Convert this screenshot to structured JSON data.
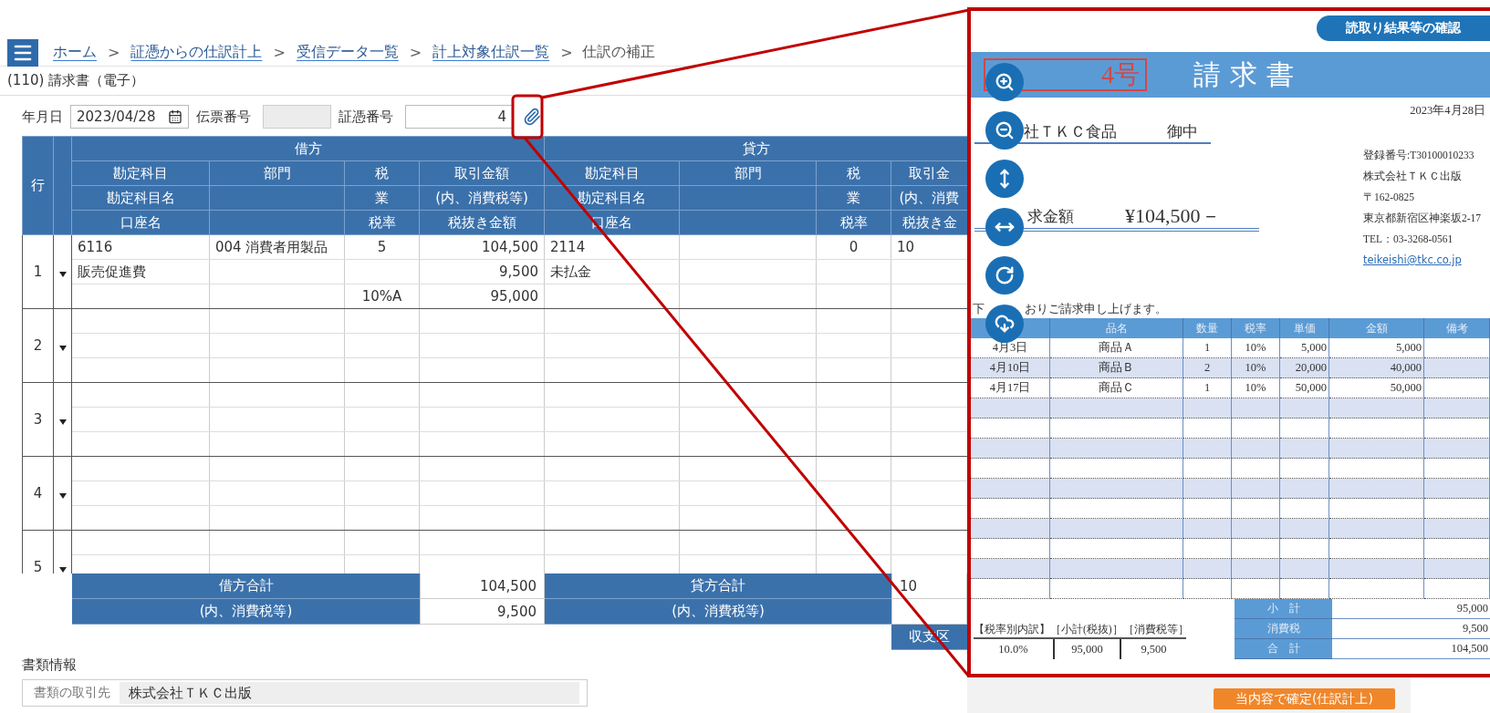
{
  "breadcrumb": [
    {
      "kind": "link",
      "label": "ホーム"
    },
    {
      "kind": "separator",
      "label": ">"
    },
    {
      "kind": "link",
      "label": "証憑からの仕訳計上"
    },
    {
      "kind": "separator",
      "label": ">"
    },
    {
      "kind": "link",
      "label": "受信データ一覧"
    },
    {
      "kind": "separator",
      "label": ">"
    },
    {
      "kind": "link",
      "label": "計上対象仕訳一覧"
    },
    {
      "kind": "separator",
      "label": ">"
    },
    {
      "kind": "current",
      "label": "仕訳の補正"
    }
  ],
  "document_type": "(110) 請求書（電子）",
  "form": {
    "date_label": "年月日",
    "date_value": "2023/04/28",
    "slip_label": "伝票番号",
    "voucher_label": "証憑番号",
    "voucher_value": "4"
  },
  "journal": {
    "row_header": "行",
    "sides": [
      "借方",
      "貸方"
    ],
    "columns": [
      {
        "lines": [
          "勘定科目",
          "勘定科目名",
          "口座名"
        ]
      },
      {
        "lines": [
          "部門"
        ]
      },
      {
        "lines": [
          "税",
          "業",
          "税率"
        ]
      },
      {
        "lines": [
          "取引金額",
          "(内、消費税等)",
          "税抜き金額"
        ]
      },
      {
        "lines": [
          "勘定科目",
          "勘定科目名",
          "口座名"
        ]
      },
      {
        "lines": [
          "部門"
        ]
      },
      {
        "lines": [
          "税",
          "業",
          "税率"
        ]
      },
      {
        "lines": [
          "取引金",
          "(内、消費",
          "税抜き金"
        ]
      }
    ],
    "rows": [
      {
        "number": "1",
        "lines": [
          {
            "debit_account": "6116",
            "debit_department": "004 消費者用製品",
            "debit_tax": "5",
            "debit_amount": "104,500",
            "credit_account": "2114",
            "credit_tax": "0",
            "credit_amount": "10"
          },
          {
            "debit_account": "販売促進費",
            "debit_amount": "9,500",
            "credit_account": "未払金"
          },
          {
            "debit_tax": "10%A",
            "debit_amount": "95,000"
          }
        ]
      },
      {
        "number": "2"
      },
      {
        "number": "3"
      },
      {
        "number": "4"
      },
      {
        "number": "5"
      }
    ]
  },
  "totals": {
    "rows": [
      {
        "debit_label": "借方合計",
        "debit_value": "104,500",
        "credit_label": "貸方合計",
        "credit_value": "10"
      },
      {
        "debit_label": "(内、消費税等)",
        "debit_value": "9,500",
        "credit_label": "(内、消費税等)"
      }
    ],
    "category_label": "収支区"
  },
  "document_info": {
    "title": "書類情報",
    "partner_label": "書類の取引先",
    "partner_value": "株式会社ＴＫＣ出版"
  },
  "viewer": {
    "check_button": "読取り結果等の確認",
    "tools": [
      {
        "kind": "zoom_in"
      },
      {
        "kind": "zoom_out"
      },
      {
        "kind": "fit_height"
      },
      {
        "kind": "fit_width"
      },
      {
        "kind": "rotate"
      },
      {
        "kind": "download"
      }
    ],
    "invoice": {
      "number": "4号",
      "title": "請求書",
      "date": "2023年4月28日",
      "recipient": "社ＴＫＣ食品",
      "honorific": "御中",
      "amount_label": "求金額",
      "amount": "¥104,500－",
      "issuer_lines": [
        "登録番号:T30100010233",
        "株式会社ＴＫＣ出版",
        "〒162-0825",
        "東京都新宿区神楽坂2-17",
        "TEL：03-3268-0561"
      ],
      "email": "teikeishi@tkc.co.jp",
      "greeting": [
        "下",
        "おりご請求申し上げます。"
      ],
      "columns": [
        "品名",
        "数量",
        "税率",
        "単価",
        "金額",
        "備考"
      ],
      "items": [
        [
          "4月3日",
          "商品Ａ",
          "1",
          "10%",
          "5,000",
          "5,000"
        ],
        [
          "4月10日",
          "商品Ｂ",
          "2",
          "10%",
          "20,000",
          "40,000"
        ],
        [
          "4月17日",
          "商品Ｃ",
          "1",
          "10%",
          "50,000",
          "50,000"
        ]
      ],
      "breakdown_headers": [
        "【税率別内訳】",
        "［小計(税抜)］",
        "［消費税等］"
      ],
      "breakdown_values": [
        "10.0%",
        "95,000",
        "9,500"
      ],
      "summary": [
        {
          "label": "小　計",
          "value": "95,000"
        },
        {
          "label": "消費税",
          "value": "9,500"
        },
        {
          "label": "合　計",
          "value": "104,500"
        }
      ]
    }
  },
  "submit_button": "当内容で確定(仕訳計上)"
}
